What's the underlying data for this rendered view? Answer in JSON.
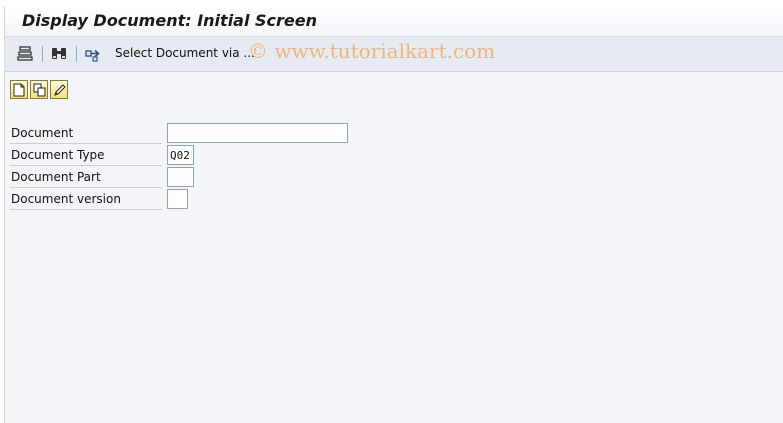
{
  "window": {
    "title": "Display Document: Initial Screen"
  },
  "toolbar": {
    "items": [
      {
        "icon": "list-icon"
      },
      {
        "icon": "binoculars-icon"
      },
      {
        "icon": "select-arrow-icon"
      }
    ],
    "select_label": "Select Document via ...",
    "watermark": "© www.tutorialkart.com"
  },
  "actions": [
    {
      "icon": "create-document-icon"
    },
    {
      "icon": "copy-document-icon"
    },
    {
      "icon": "change-document-icon"
    }
  ],
  "form": {
    "document": {
      "label": "Document",
      "value": ""
    },
    "document_type": {
      "label": "Document Type",
      "value": "Q02"
    },
    "document_part": {
      "label": "Document Part",
      "value": ""
    },
    "document_version": {
      "label": "Document version",
      "value": ""
    }
  },
  "colors": {
    "frame": "#f3f5f8",
    "appbar": "#e6ebf1",
    "button": "#f3e27a"
  }
}
